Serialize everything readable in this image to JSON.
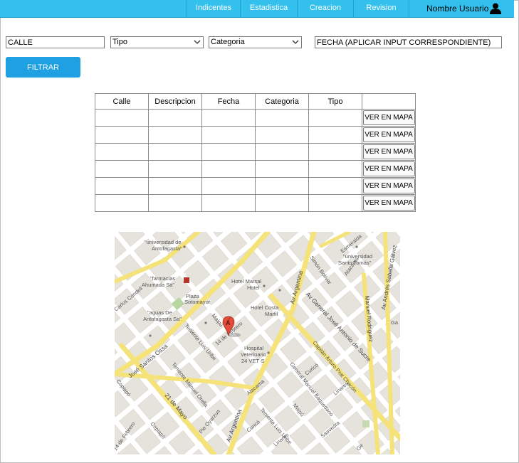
{
  "nav": {
    "items": [
      {
        "label": "Indicentes"
      },
      {
        "label": "Estadistica"
      },
      {
        "label": "Creacion Sector"
      },
      {
        "label": "Revision Sector"
      }
    ],
    "user_label": "Nombre Usuario"
  },
  "filters": {
    "calle_value": "CALLE",
    "tipo_value": "Tipo",
    "categoria_value": "Categoria",
    "fecha_value": "FECHA (APLICAR INPUT CORRESPONDIENTE)",
    "filtrar_label": "FILTRAR"
  },
  "table": {
    "headers": [
      "Calle",
      "Descripcion",
      "Fecha",
      "Categoria",
      "Tipo"
    ],
    "row_button_label": "VER EN MAPA",
    "rows": 6
  },
  "map": {
    "marker_letter": "A",
    "labels": {
      "u_antofagasta": "\"universidad de",
      "u_antofagasta2": "Antofagasta\"",
      "farmacias": "\"farmacias",
      "farmacias2": "Ahumada Sa\"",
      "carlos_condell": "Carlos Condell",
      "plaza": "Plaza",
      "plaza2": "Sotomayor",
      "aguas": "\"aguas De",
      "aguas2": "Antofagasta Sa\"",
      "hotel_marsal": "Hotel Marsal",
      "hotel_marsal2": "Hotel",
      "hotel_costa": "Hotel Costa",
      "hotel_costa2": "Marfil",
      "maipu_top": "Maipú",
      "catorce": "14 de Febrero",
      "teniente_uribe": "Teniente Luis Uribe",
      "jose_ossa": "José Santos Ossa",
      "hospital": "Hospital",
      "hospital2": "Veterinario",
      "hospital3": "24 VET·S",
      "av_argentina": "Av Argentina",
      "av_general": "Av General José Antonio de Sucre",
      "simon_bolivar": "Simón Bolívar",
      "u_santo_tomas": "\"universidad",
      "u_santo_tomas2": "Santo Tomás\"",
      "esmeralda": "Esmeralda",
      "atacama": "Atacama",
      "manuel_rodriguez": "Manuel Rodríguez",
      "av_sabella": "Av Andrés Sabella Gálvez",
      "ga": "Ga",
      "capitan": "Capitán Arturo Prat Chacón",
      "curico": "Curicó",
      "linares": "Linares",
      "general_manuel": "General Manuel Baquedano",
      "teniente_orella": "Teniente Manuel Orella",
      "veintiuno": "21 de Mayo",
      "atacama2": "Atacama",
      "pie": "Pie Oyarzun",
      "av_argentina2": "Av Argentina",
      "curico2": "Curicó",
      "teniente_uribe2": "Teniente Luis Uribe",
      "linares2": "Linares",
      "maipu2": "Maipú",
      "saavedra": "Saavedra",
      "copiapo": "Copiapó",
      "copiapo_left": "Copiapó",
      "catorce2": "14 de Febrero",
      "ge": "Ge"
    }
  }
}
